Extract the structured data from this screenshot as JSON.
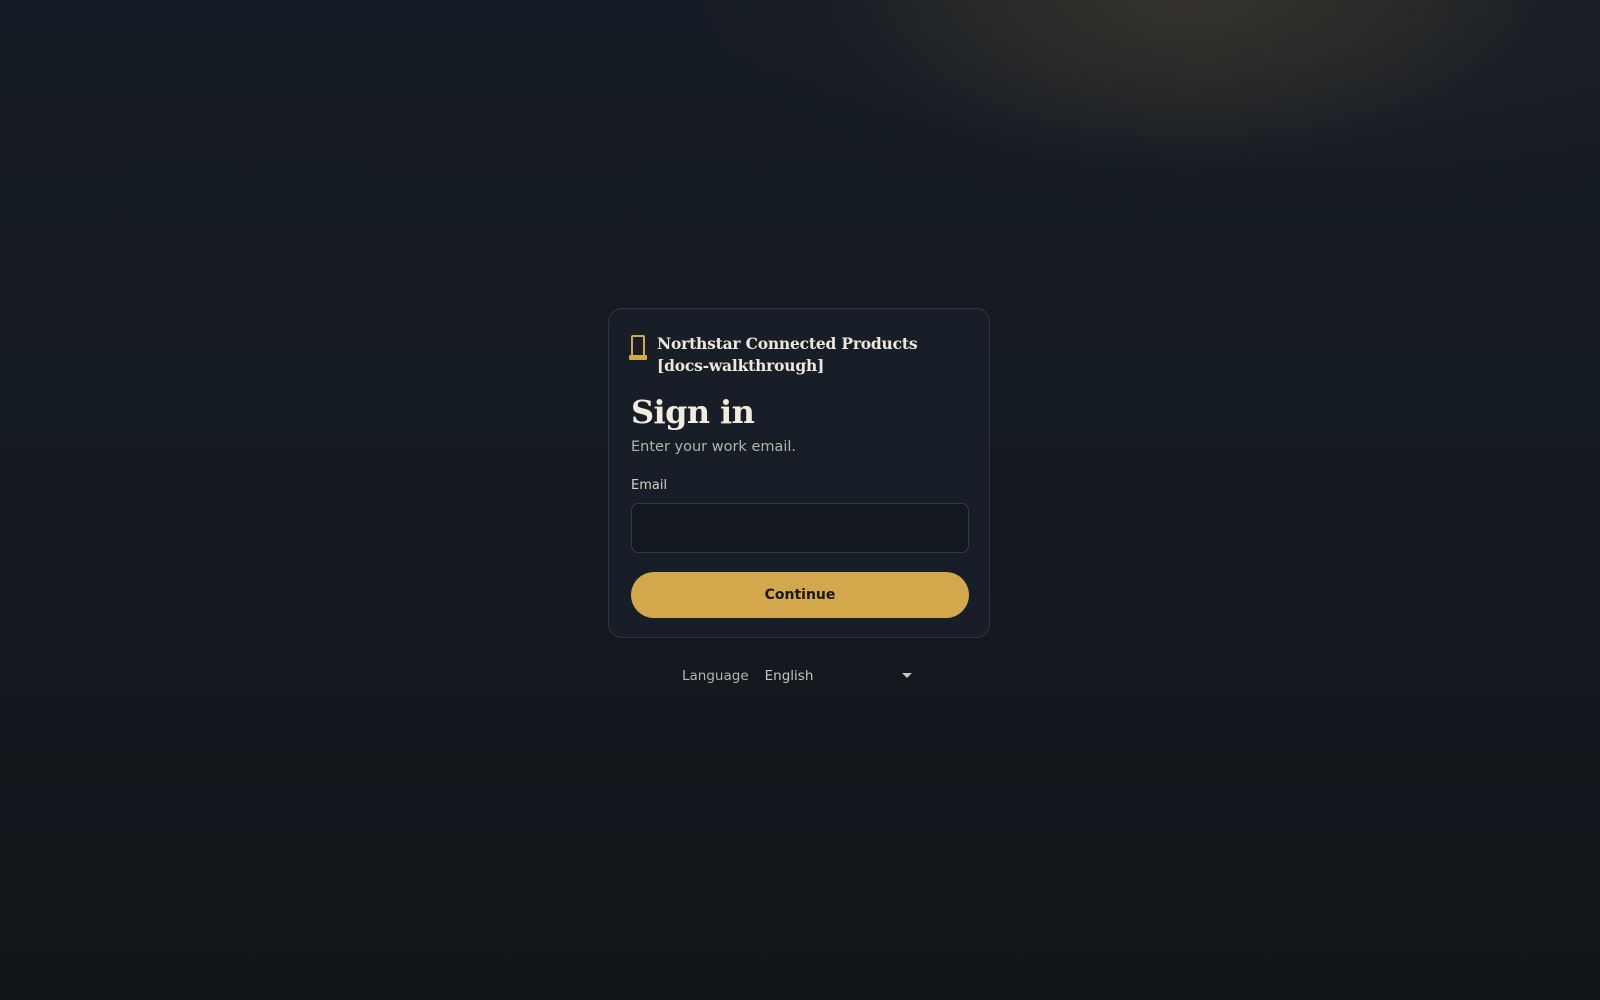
{
  "brand": {
    "name": "Northstar Connected Products [docs-walkthrough]",
    "icon": "door-icon",
    "accent_color": "#d3a74c"
  },
  "signin": {
    "title": "Sign in",
    "subtitle": "Enter your work email.",
    "email_label": "Email",
    "email_value": "",
    "email_placeholder": "",
    "continue_label": "Continue"
  },
  "language": {
    "label": "Language",
    "selected": "English"
  }
}
